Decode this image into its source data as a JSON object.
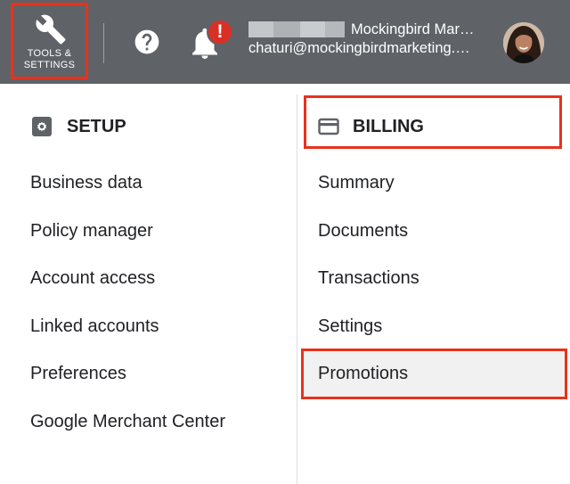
{
  "header": {
    "tools_label": "TOOLS &\nSETTINGS",
    "alert_badge": "!",
    "account_name": "Mockingbird Mar…",
    "account_email": "chaturi@mockingbirdmarketing.…"
  },
  "icons": {
    "tools": "wrench-icon",
    "help": "help-icon",
    "notifications": "bell-icon",
    "setup": "gear-icon",
    "billing": "credit-card-icon"
  },
  "setup": {
    "heading": "SETUP",
    "items": [
      {
        "label": "Business data"
      },
      {
        "label": "Policy manager"
      },
      {
        "label": "Account access"
      },
      {
        "label": "Linked accounts"
      },
      {
        "label": "Preferences"
      },
      {
        "label": "Google Merchant Center"
      }
    ]
  },
  "billing": {
    "heading": "BILLING",
    "items": [
      {
        "label": "Summary"
      },
      {
        "label": "Documents"
      },
      {
        "label": "Transactions"
      },
      {
        "label": "Settings"
      },
      {
        "label": "Promotions"
      }
    ]
  },
  "colors": {
    "header_bg": "#5f6368",
    "highlight_border": "#e8321c",
    "alert_badge": "#d93025",
    "hover_bg": "#f1f1f1"
  }
}
